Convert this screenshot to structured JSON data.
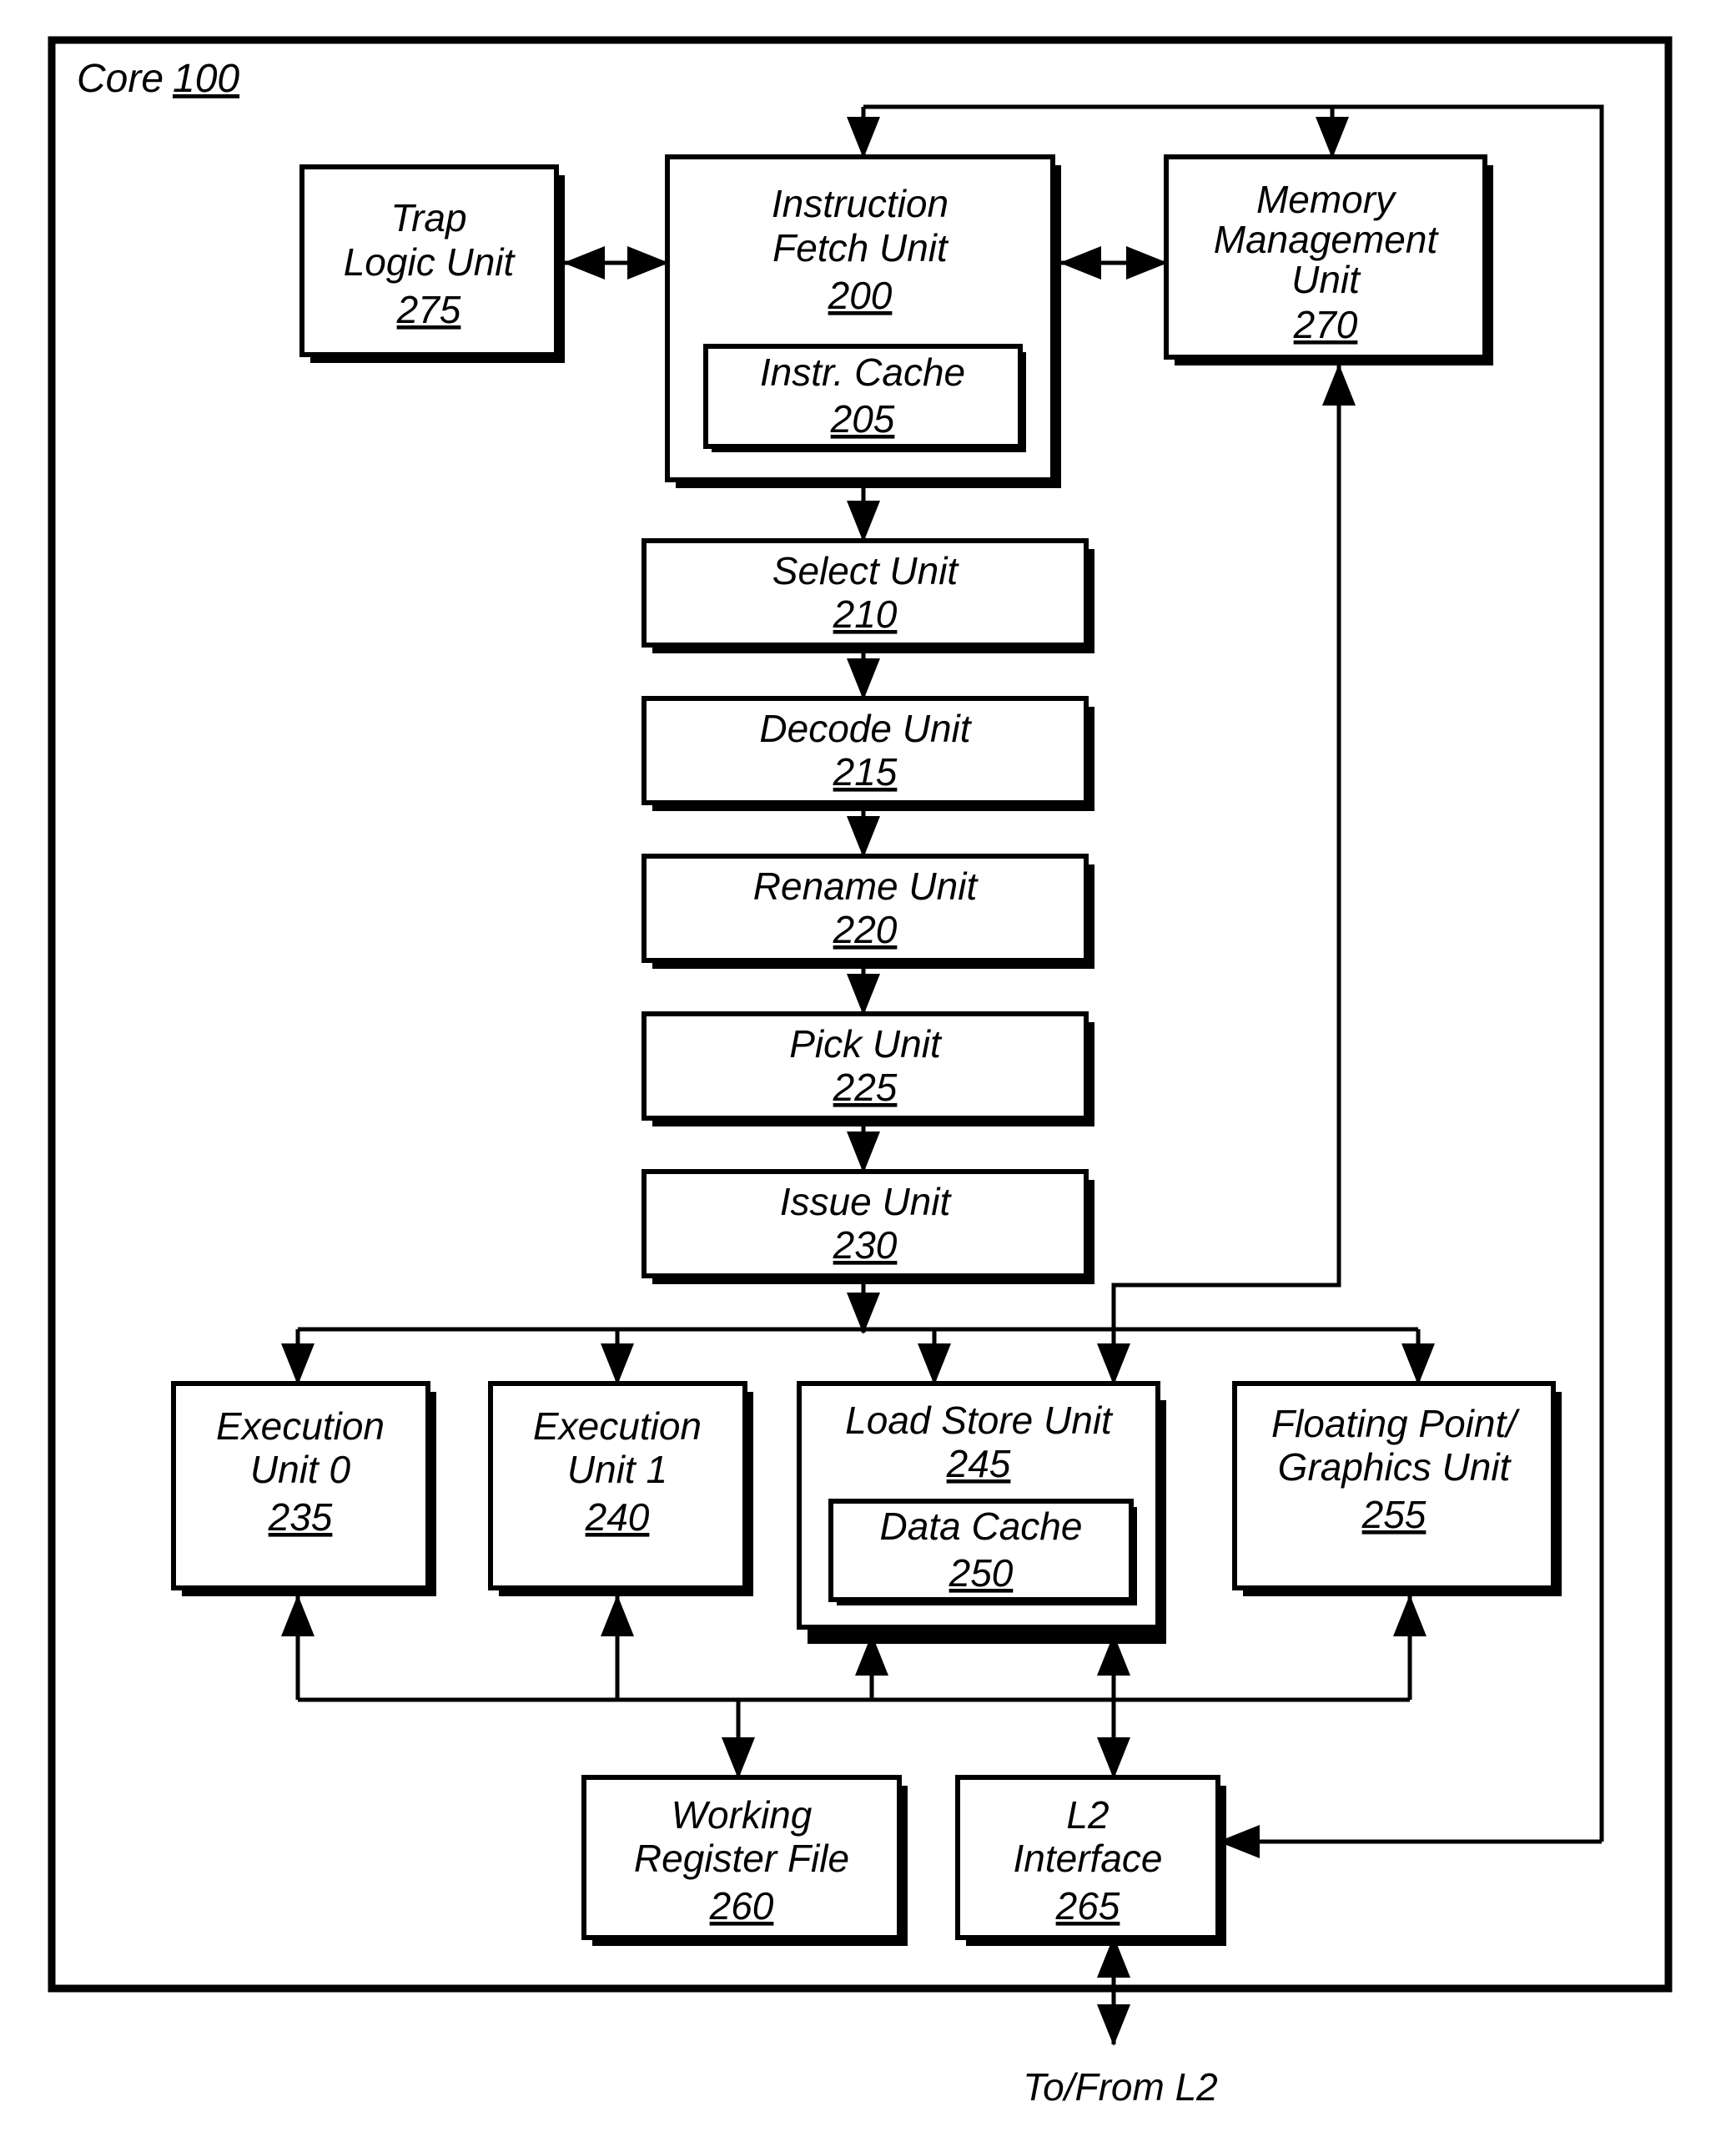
{
  "figure": {
    "core_label": "Core",
    "core_ref": "100",
    "external_label": "To/From L2"
  },
  "blocks": {
    "trap_logic_unit": {
      "lines": [
        "Trap",
        "Logic Unit"
      ],
      "ref": "275"
    },
    "instruction_fetch_unit": {
      "lines": [
        "Instruction",
        "Fetch Unit"
      ],
      "ref": "200"
    },
    "instr_cache": {
      "lines": [
        "Instr. Cache"
      ],
      "ref": "205"
    },
    "memory_management_unit": {
      "lines": [
        "Memory",
        "Management",
        "Unit"
      ],
      "ref": "270"
    },
    "select_unit": {
      "lines": [
        "Select Unit"
      ],
      "ref": "210"
    },
    "decode_unit": {
      "lines": [
        "Decode Unit"
      ],
      "ref": "215"
    },
    "rename_unit": {
      "lines": [
        "Rename Unit"
      ],
      "ref": "220"
    },
    "pick_unit": {
      "lines": [
        "Pick Unit"
      ],
      "ref": "225"
    },
    "issue_unit": {
      "lines": [
        "Issue Unit"
      ],
      "ref": "230"
    },
    "execution_unit_0": {
      "lines": [
        "Execution",
        "Unit 0"
      ],
      "ref": "235"
    },
    "execution_unit_1": {
      "lines": [
        "Execution",
        "Unit 1"
      ],
      "ref": "240"
    },
    "load_store_unit": {
      "lines": [
        "Load Store Unit"
      ],
      "ref": "245"
    },
    "data_cache": {
      "lines": [
        "Data Cache"
      ],
      "ref": "250"
    },
    "floating_point_graphics_unit": {
      "lines": [
        "Floating Point/",
        "Graphics Unit"
      ],
      "ref": "255"
    },
    "working_register_file": {
      "lines": [
        "Working",
        "Register File"
      ],
      "ref": "260"
    },
    "l2_interface": {
      "lines": [
        "L2",
        "Interface"
      ],
      "ref": "265"
    }
  },
  "colors": {
    "ink": "#000000",
    "paper": "#ffffff"
  }
}
